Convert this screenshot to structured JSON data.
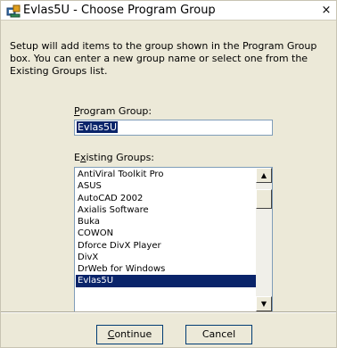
{
  "window": {
    "title": "Evlas5U - Choose Program Group",
    "close_glyph": "×",
    "icon": "setup-icon"
  },
  "description": "Setup will add items to the group shown in the Program Group box.  You can enter a new group name or select one from the Existing Groups list.",
  "program_group": {
    "label_accel": "P",
    "label_rest": "rogram Group:",
    "value": "Evlas5U"
  },
  "existing_groups": {
    "label_pre": "E",
    "label_accel": "x",
    "label_rest": "isting Groups:",
    "items": [
      "AntiViral Toolkit Pro",
      "ASUS",
      "AutoCAD 2002",
      "Axialis Software",
      "Buka",
      "COWON",
      "Dforce DivX Player",
      "DivX",
      "DrWeb for Windows",
      "Evlas5U"
    ],
    "selected": "Evlas5U",
    "scroll_up_glyph": "▲",
    "scroll_down_glyph": "▼"
  },
  "buttons": {
    "continue_accel": "C",
    "continue_rest": "ontinue",
    "cancel": "Cancel"
  },
  "colors": {
    "window_bg": "#ece9d8",
    "selection": "#0a246a",
    "field_border": "#7f9db9"
  }
}
